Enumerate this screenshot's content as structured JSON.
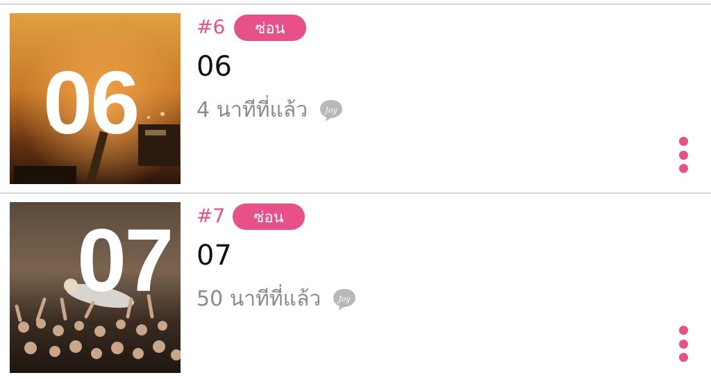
{
  "items": [
    {
      "rank": "#6",
      "hide_label": "ซ่อน",
      "thumbnail_number": "06",
      "title": "06",
      "time_ago": "4 นาทีที่แล้ว",
      "joy_badge": "Joy",
      "icon": "more-vertical-icon"
    },
    {
      "rank": "#7",
      "hide_label": "ซ่อน",
      "thumbnail_number": "07",
      "title": "07",
      "time_ago": "50 นาทีที่แล้ว",
      "joy_badge": "Joy",
      "icon": "more-vertical-icon"
    }
  ],
  "colors": {
    "accent": "#e8508a",
    "muted_text": "#8a8a8a",
    "divider": "#d8d8d8"
  }
}
